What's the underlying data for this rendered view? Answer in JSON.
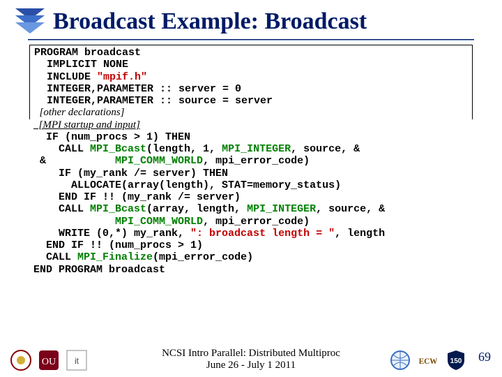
{
  "header": {
    "title": "Broadcast Example: Broadcast"
  },
  "code": {
    "l1": "PROGRAM broadcast",
    "l2": "  IMPLICIT NONE",
    "l3a": "  INCLUDE ",
    "l3b": "\"mpif.h\"",
    "l4": "  INTEGER,PARAMETER :: server = 0",
    "l5": "  INTEGER,PARAMETER :: source = server",
    "l6": "  [other declarations]",
    "l7": "  [MPI startup and input]",
    "l8": "  IF (num_procs > 1) THEN",
    "l9a": "    CALL ",
    "l9b": "MPI_Bcast",
    "l9c": "(length, 1, ",
    "l9d": "MPI_INTEGER",
    "l9e": ", source, &",
    "l10a": " &           ",
    "l10b": "MPI_COMM_WORLD",
    "l10c": ", mpi_error_code)",
    "l11": "    IF (my_rank /= server) THEN",
    "l12": "      ALLOCATE(array(length), STAT=memory_status)",
    "l13": "    END IF !! (my_rank /= server)",
    "l14a": "    CALL ",
    "l14b": "MPI_Bcast",
    "l14c": "(array, length, ",
    "l14d": "MPI_INTEGER",
    "l14e": ", source, &",
    "l15a": "             ",
    "l15b": "MPI_COMM_WORLD",
    "l15c": ", mpi_error_code)",
    "l16a": "    WRITE (0,*) my_rank, ",
    "l16b": "\": broadcast length = \"",
    "l16c": ", length",
    "l17": "  END IF !! (num_procs > 1)",
    "l18a": "  CALL ",
    "l18b": "MPI_Finalize",
    "l18c": "(mpi_error_code)",
    "l19": "END PROGRAM broadcast"
  },
  "footer": {
    "line1": "NCSI Intro Parallel: Distributed Multiproc",
    "line2": "June 26 - July 1 2011",
    "page": "69"
  }
}
